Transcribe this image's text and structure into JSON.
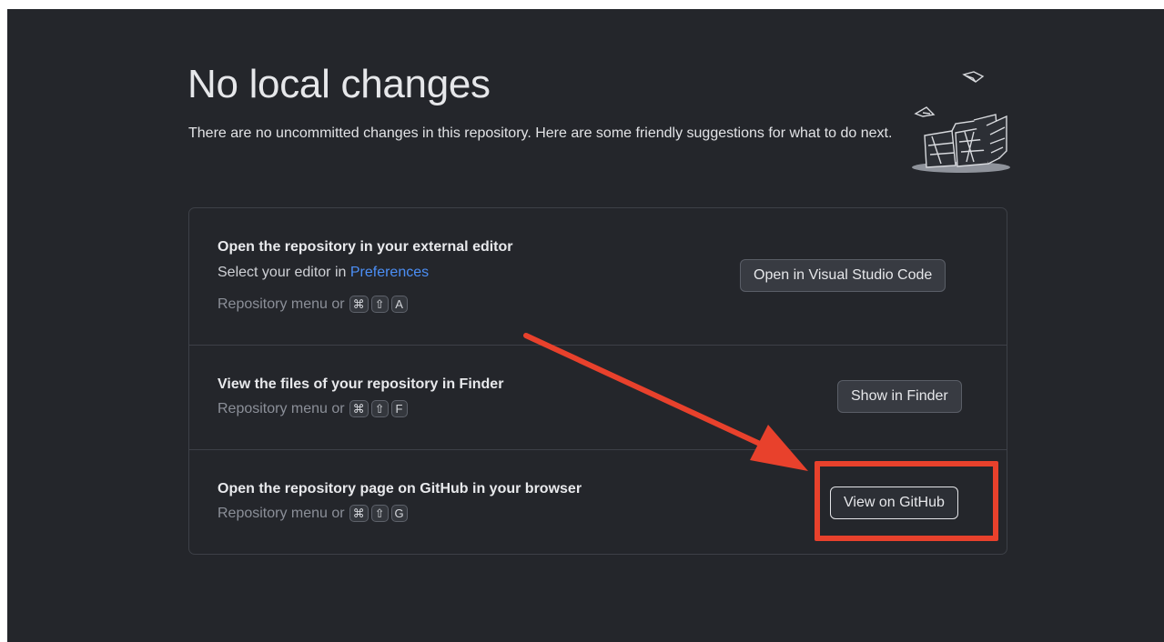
{
  "header": {
    "title": "No local changes",
    "description": "There are no uncommitted changes in this repository. Here are some friendly suggestions for what to do next."
  },
  "suggestions": [
    {
      "title": "Open the repository in your external editor",
      "subtitle_prefix": "Select your editor in",
      "subtitle_link": "Preferences",
      "hint_prefix": "Repository menu or",
      "shortcut": [
        "⌘",
        "⇧",
        "A"
      ],
      "button": "Open in Visual Studio Code"
    },
    {
      "title": "View the files of your repository in Finder",
      "hint_prefix": "Repository menu or",
      "shortcut": [
        "⌘",
        "⇧",
        "F"
      ],
      "button": "Show in Finder"
    },
    {
      "title": "Open the repository page on GitHub in your browser",
      "hint_prefix": "Repository menu or",
      "shortcut": [
        "⌘",
        "⇧",
        "G"
      ],
      "button": "View on GitHub"
    }
  ],
  "icons": {
    "illustration": "paper-stacks-illustration-icon",
    "annotation_arrow": "arrow-icon"
  },
  "colors": {
    "background": "#24262b",
    "link": "#4c8ff6",
    "annotation": "#e8412c"
  }
}
